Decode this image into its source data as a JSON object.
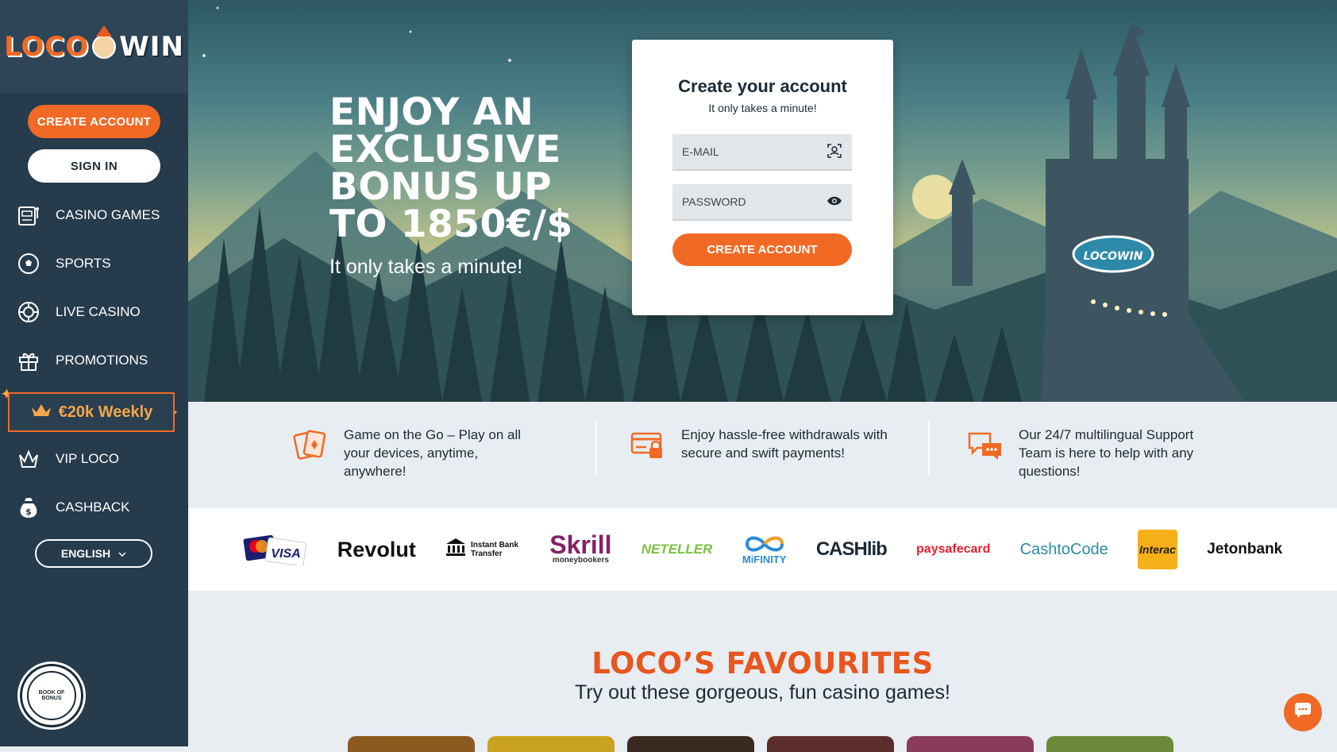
{
  "brand": {
    "name_left": "LOCO",
    "name_right": "WIN"
  },
  "sidebar": {
    "create_account": "CREATE ACCOUNT",
    "sign_in": "SIGN IN",
    "items": [
      {
        "label": "CASINO GAMES",
        "icon": "slot-machine-icon"
      },
      {
        "label": "SPORTS",
        "icon": "soccer-ball-icon"
      },
      {
        "label": "LIVE CASINO",
        "icon": "roulette-chip-icon"
      },
      {
        "label": "PROMOTIONS",
        "icon": "gift-icon"
      },
      {
        "label": "VIP LOCO",
        "icon": "crown-icon"
      },
      {
        "label": "CASHBACK",
        "icon": "money-bag-icon"
      }
    ],
    "weekly": "€20k Weekly",
    "language": "ENGLISH",
    "book_badge": "BOOK OF BONUS"
  },
  "hero": {
    "title": "ENJOY AN EXCLUSIVE BONUS UP TO 1850€/$",
    "subtitle": "It only takes a minute!"
  },
  "form": {
    "title": "Create your account",
    "subtitle": "It only takes a minute!",
    "email_placeholder": "E-MAIL",
    "password_placeholder": "PASSWORD",
    "submit": "CREATE ACCOUNT"
  },
  "features": [
    {
      "text": "Game on the Go – Play on all your devices, anytime, anywhere!",
      "icon": "cards-icon"
    },
    {
      "text": "Enjoy hassle-free withdrawals with secure and swift payments!",
      "icon": "secure-card-icon"
    },
    {
      "text": "Our 24/7 multilingual Support Team is here to help with any questions!",
      "icon": "chat-bubbles-icon"
    }
  ],
  "payments": [
    "VISA",
    "Revolut",
    "Instant Bank Transfer",
    "Skrill",
    "moneybookers",
    "NETELLER",
    "MiFINITY",
    "CASHlib",
    "paysafecard",
    "CashtoCode",
    "Interac",
    "Jetonbank"
  ],
  "favourites": {
    "title": "LOCO’S FAVOURITES",
    "subtitle": "Try out these gorgeous, fun casino games!"
  },
  "colors": {
    "accent": "#f06a25",
    "sidebar": "#263b4c",
    "dark_text": "#1b2a36"
  }
}
